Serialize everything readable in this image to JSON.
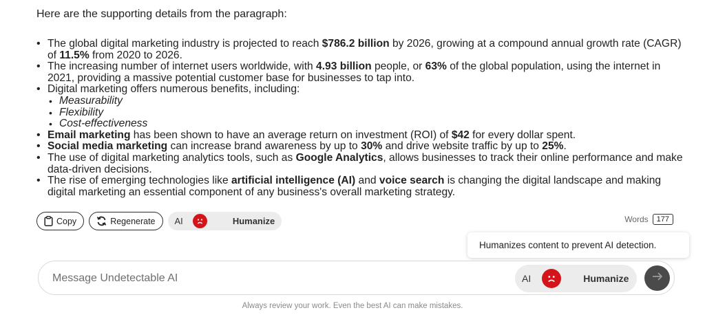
{
  "intro": "Here are the supporting details from the paragraph:",
  "bullets": {
    "b1": {
      "t1": "The global digital marketing industry is projected to reach ",
      "b1": "$786.2 billion",
      "t2": " by 2026, growing at a compound annual growth rate (CAGR) of ",
      "b2": "11.5%",
      "t3": " from 2020 to 2026."
    },
    "b2": {
      "t1": "The increasing number of internet users worldwide, with ",
      "b1": "4.93 billion",
      "t2": " people, or ",
      "b2": "63%",
      "t3": " of the global population, using the internet in 2021, providing a massive potential customer base for businesses to tap into."
    },
    "b3": {
      "t1": "Digital marketing offers numerous benefits, including:",
      "sub": [
        "Measurability",
        "Flexibility",
        "Cost-effectiveness"
      ]
    },
    "b4": {
      "b1": "Email marketing",
      "t1": " has been shown to have an average return on investment (ROI) of ",
      "b2": "$42",
      "t2": " for every dollar spent."
    },
    "b5": {
      "b1": "Social media marketing",
      "t1": " can increase brand awareness by up to ",
      "b2": "30%",
      "t2": " and drive website traffic by up to ",
      "b3": "25%",
      "t3": "."
    },
    "b6": {
      "t1": "The use of digital marketing analytics tools, such as ",
      "b1": "Google Analytics",
      "t2": ", allows businesses to track their online performance and make data-driven decisions."
    },
    "b7": {
      "t1": "The rise of emerging technologies like ",
      "b1": "artificial intelligence (AI)",
      "t2": " and ",
      "b2": "voice search",
      "t3": " is changing the digital landscape and making digital marketing an essential component of any business's overall marketing strategy."
    }
  },
  "actions": {
    "copy_label": "Copy",
    "regenerate_label": "Regenerate",
    "toggle_ai": "AI",
    "toggle_humanize": "Humanize"
  },
  "words": {
    "label": "Words",
    "count": "177"
  },
  "tooltip": "Humanizes content to prevent AI detection.",
  "composer": {
    "placeholder": "Message Undetectable AI",
    "value": "",
    "toggle_ai": "AI",
    "toggle_humanize": "Humanize"
  },
  "disclaimer": "Always review your work. Even the best AI can make mistakes.",
  "colors": {
    "accent_red": "#d3151b",
    "send_bg": "#4a4a4a",
    "toggle_bg": "#ececec"
  }
}
